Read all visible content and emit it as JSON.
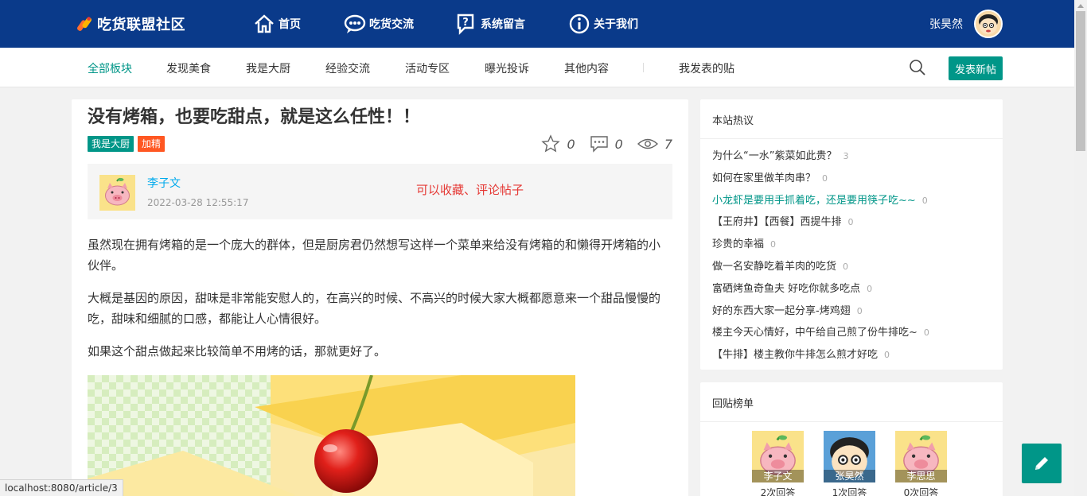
{
  "header": {
    "logo_text": "吃货联盟社区",
    "nav": [
      {
        "label": "首页",
        "icon": "home-icon"
      },
      {
        "label": "吃货交流",
        "icon": "chat-icon"
      },
      {
        "label": "系统留言",
        "icon": "message-question-icon"
      },
      {
        "label": "关于我们",
        "icon": "info-icon"
      }
    ],
    "username": "张昊然"
  },
  "subnav": {
    "tabs": [
      "全部板块",
      "发现美食",
      "我是大厨",
      "经验交流",
      "活动专区",
      "曝光投诉",
      "其他内容"
    ],
    "active_tab": "全部板块",
    "my_posts": "我发表的贴",
    "new_post_button": "发表新帖"
  },
  "post": {
    "title": "没有烤箱，也要吃甜点，就是这么任性！！",
    "tags": [
      {
        "label": "我是大厨",
        "color": "#009688"
      },
      {
        "label": "加精",
        "color": "#ff5722"
      }
    ],
    "stats": {
      "favorites": "0",
      "comments": "0",
      "views": "7"
    },
    "author": {
      "name": "李子文",
      "time": "2022-03-28 12:55:17",
      "note": "可以收藏、评论帖子"
    },
    "paragraphs": [
      "虽然现在拥有烤箱的是一个庞大的群体，但是厨房君仍然想写这样一个菜单来给没有烤箱的和懒得开烤箱的小伙伴。",
      "大概是基因的原因，甜味是非常能安慰人的，在高兴的时候、不高兴的时候大家大概都愿意来一个甜品慢慢的吃，甜味和细腻的口感，都能让人心情很好。",
      "如果这个甜点做起来比较简单不用烤的话，那就更好了。"
    ]
  },
  "sidebar": {
    "hot_title": "本站热议",
    "hot_items": [
      {
        "title": "为什么“一水”紫菜如此贵？",
        "count": "3"
      },
      {
        "title": "如何在家里做羊肉串？",
        "count": "0"
      },
      {
        "title": "小龙虾是要用手抓着吃，还是要用筷子吃~~",
        "count": "0"
      },
      {
        "title": "【王府井】【西餐】西提牛排",
        "count": "0"
      },
      {
        "title": "珍贵的幸福",
        "count": "0"
      },
      {
        "title": "做一名安静吃着羊肉的吃货",
        "count": "0"
      },
      {
        "title": "富硒烤鱼奇鱼夫 好吃你就多吃点",
        "count": "0"
      },
      {
        "title": "好的东西大家一起分享-烤鸡翅",
        "count": "0"
      },
      {
        "title": "楼主今天心情好，中午给自己煎了份牛排吃~",
        "count": "0"
      },
      {
        "title": "【牛排】楼主教你牛排怎么煎才好吃",
        "count": "0"
      }
    ],
    "hot_active_index": 2,
    "rank_title": "回贴榜单",
    "rank": [
      {
        "name": "李子文",
        "count": "2次回答",
        "avatar": "pig-avatar"
      },
      {
        "name": "张昊然",
        "count": "1次回答",
        "avatar": "cartoon-boy-avatar"
      },
      {
        "name": "李思思",
        "count": "0次回答",
        "avatar": "pig-avatar"
      }
    ]
  },
  "statusbar": {
    "url": "localhost:8080/article/3"
  },
  "colors": {
    "header_bg": "#0a3a8a",
    "accent": "#009688",
    "link": "#01aaed",
    "note_red": "#e53935"
  }
}
